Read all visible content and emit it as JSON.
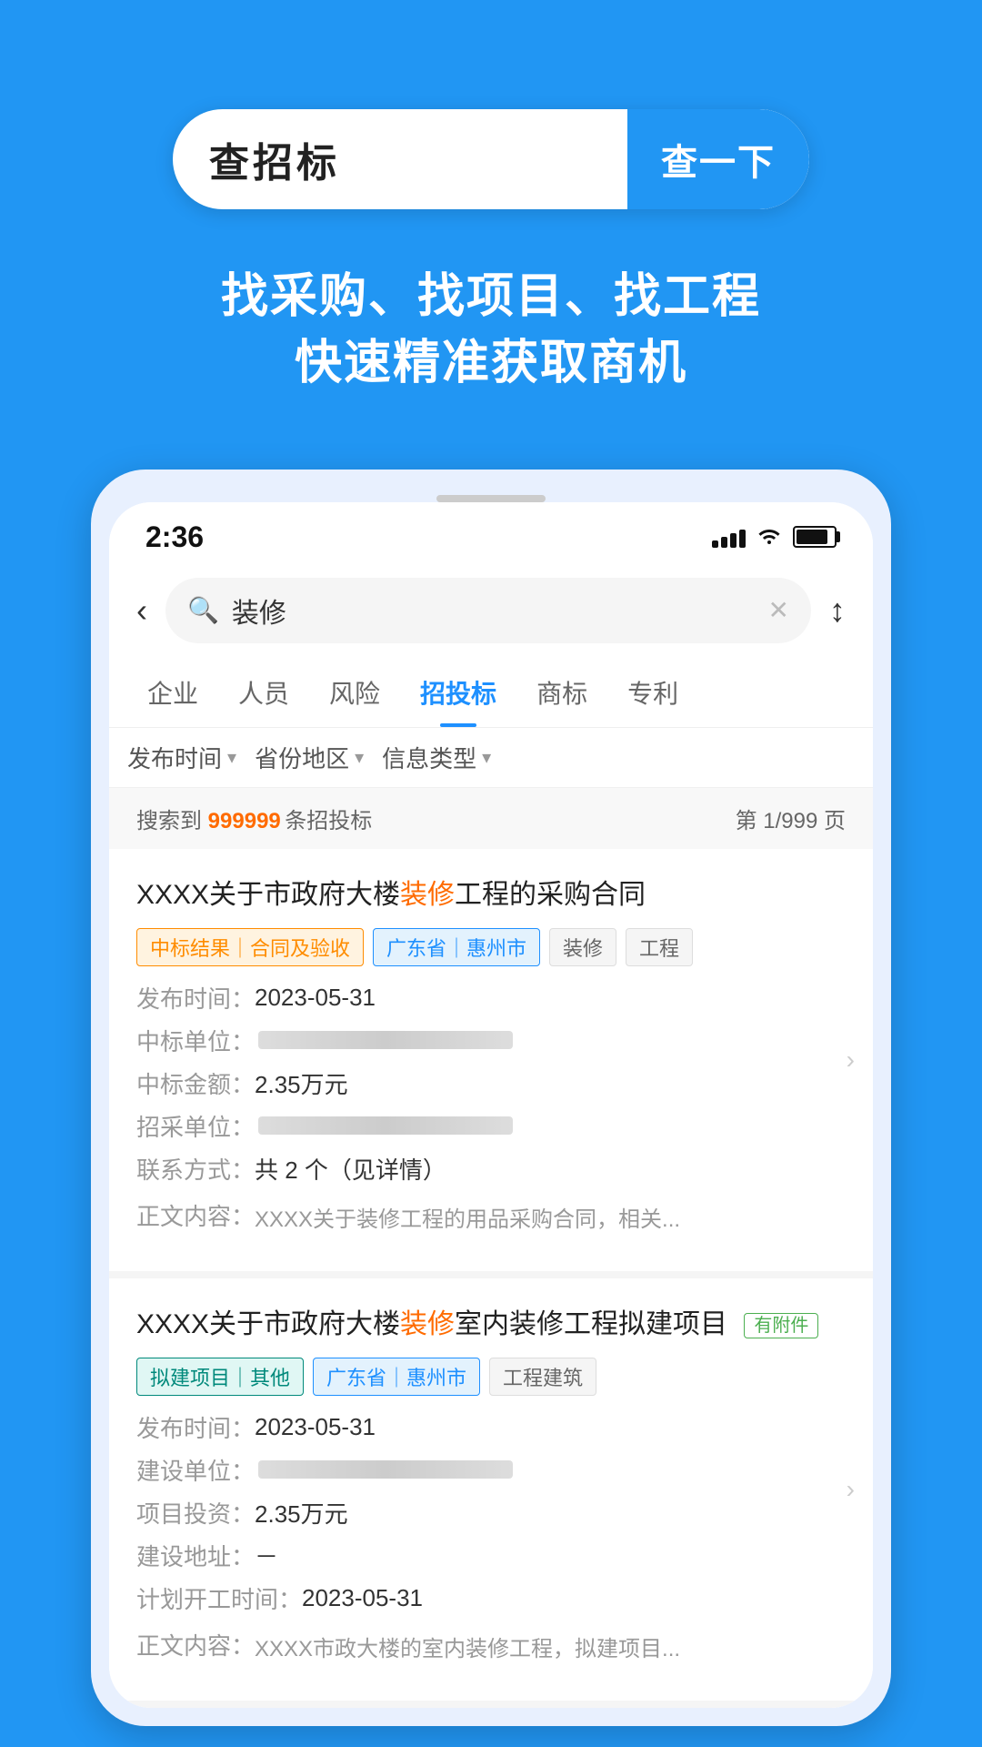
{
  "header": {
    "search_placeholder": "查招标",
    "search_btn": "查一下",
    "tagline1": "找采购、找项目、找工程",
    "tagline2": "快速精准获取商机"
  },
  "phone": {
    "status": {
      "time": "2:36"
    },
    "search_value": "装修",
    "back_label": "‹",
    "filter_label": "↑↓",
    "tabs": [
      {
        "label": "企业",
        "active": false
      },
      {
        "label": "人员",
        "active": false
      },
      {
        "label": "风险",
        "active": false
      },
      {
        "label": "招投标",
        "active": true
      },
      {
        "label": "商标",
        "active": false
      },
      {
        "label": "专利",
        "active": false
      }
    ],
    "filters": [
      {
        "label": "发布时间"
      },
      {
        "label": "省份地区"
      },
      {
        "label": "信息类型"
      }
    ],
    "results": {
      "prefix": "搜索到 ",
      "count": "999999",
      "suffix": " 条招投标",
      "page": "第 1/999 页"
    },
    "cards": [
      {
        "title_pre": "XXXX关于市政府大楼",
        "title_highlight": "装修",
        "title_post": "工程的采购合同",
        "tags": [
          {
            "text": "中标结果｜合同及验收",
            "type": "orange"
          },
          {
            "text": "广东省｜惠州市",
            "type": "blue"
          },
          {
            "text": "装修",
            "type": "gray"
          },
          {
            "text": "工程",
            "type": "gray"
          }
        ],
        "fields": [
          {
            "label": "发布时间：",
            "value": "2023-05-31",
            "blurred": false
          },
          {
            "label": "中标单位：",
            "value": "",
            "blurred": true
          },
          {
            "label": "中标金额：",
            "value": "2.35万元",
            "blurred": false
          },
          {
            "label": "招采单位：",
            "value": "",
            "blurred": true
          },
          {
            "label": "联系方式：",
            "value": "共 2 个（见详情）",
            "blurred": false
          },
          {
            "label": "正文内容：",
            "value": "XXXX关于装修工程的用品采购合同，相关...",
            "blurred": false
          }
        ],
        "has_arrow": true,
        "has_attachment": false
      },
      {
        "title_pre": "XXXX关于市政府大楼",
        "title_highlight": "装修",
        "title_post": "室内装修工程拟建项目",
        "tags": [
          {
            "text": "拟建项目｜其他",
            "type": "teal"
          },
          {
            "text": "广东省｜惠州市",
            "type": "blue"
          },
          {
            "text": "工程建筑",
            "type": "gray"
          }
        ],
        "fields": [
          {
            "label": "发布时间：",
            "value": "2023-05-31",
            "blurred": false
          },
          {
            "label": "建设单位：",
            "value": "",
            "blurred": true
          },
          {
            "label": "项目投资：",
            "value": "2.35万元",
            "blurred": false
          },
          {
            "label": "建设地址：",
            "value": "－",
            "blurred": false
          },
          {
            "label": "计划开工时间：",
            "value": "2023-05-31",
            "blurred": false
          },
          {
            "label": "正文内容：",
            "value": "XXXX市政大楼的室内装修工程，拟建项目...",
            "blurred": false
          }
        ],
        "has_arrow": true,
        "has_attachment": true,
        "attachment_label": "有附件"
      }
    ]
  }
}
